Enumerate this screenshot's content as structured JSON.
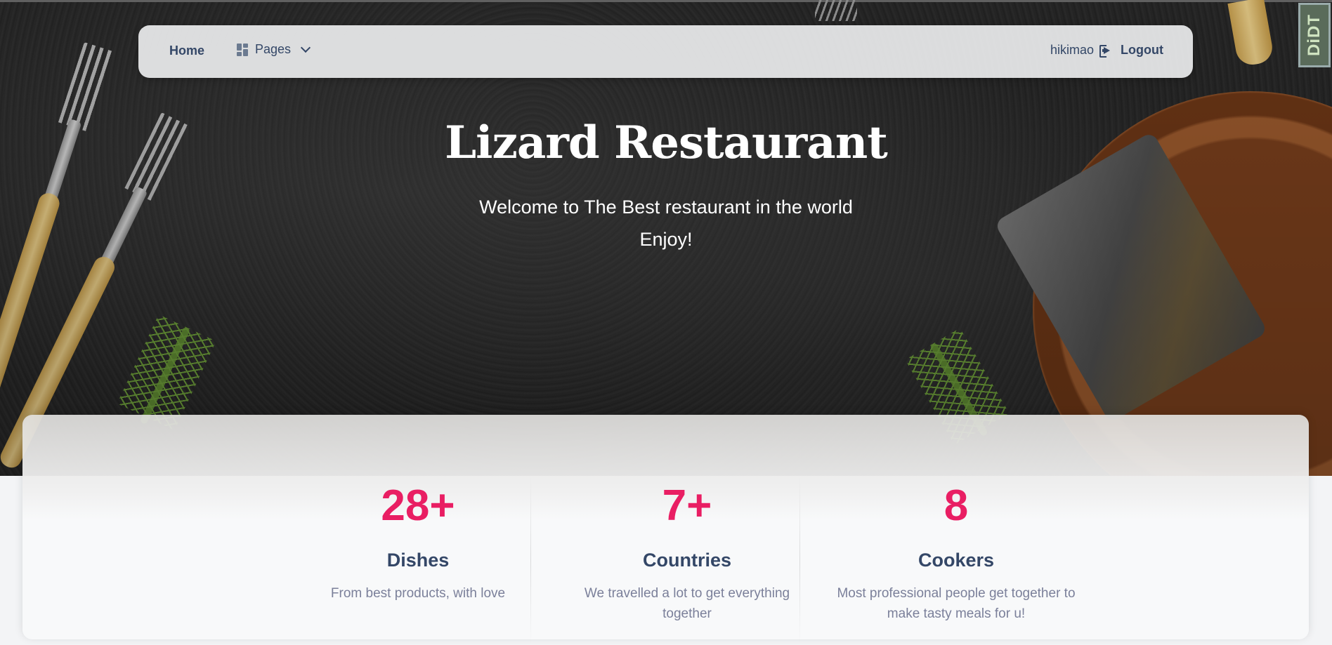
{
  "nav": {
    "home": "Home",
    "pages": "Pages",
    "username": "hikimao",
    "logout": "Logout"
  },
  "logo": {
    "text": "DiDT"
  },
  "hero": {
    "title": "Lizard Restaurant",
    "subtitle_line1": "Welcome to The Best restaurant in the world",
    "subtitle_line2": "Enjoy!"
  },
  "stats": [
    {
      "value": "28+",
      "label": "Dishes",
      "description": "From best products, with love"
    },
    {
      "value": "7+",
      "label": "Countries",
      "description": "We travelled a lot to get everything together"
    },
    {
      "value": "8",
      "label": "Cookers",
      "description": "Most professional people get together to make tasty meals for u!"
    }
  ],
  "colors": {
    "accent": "#e91e63",
    "text_dark": "#344767",
    "text_muted": "#7b809a"
  }
}
